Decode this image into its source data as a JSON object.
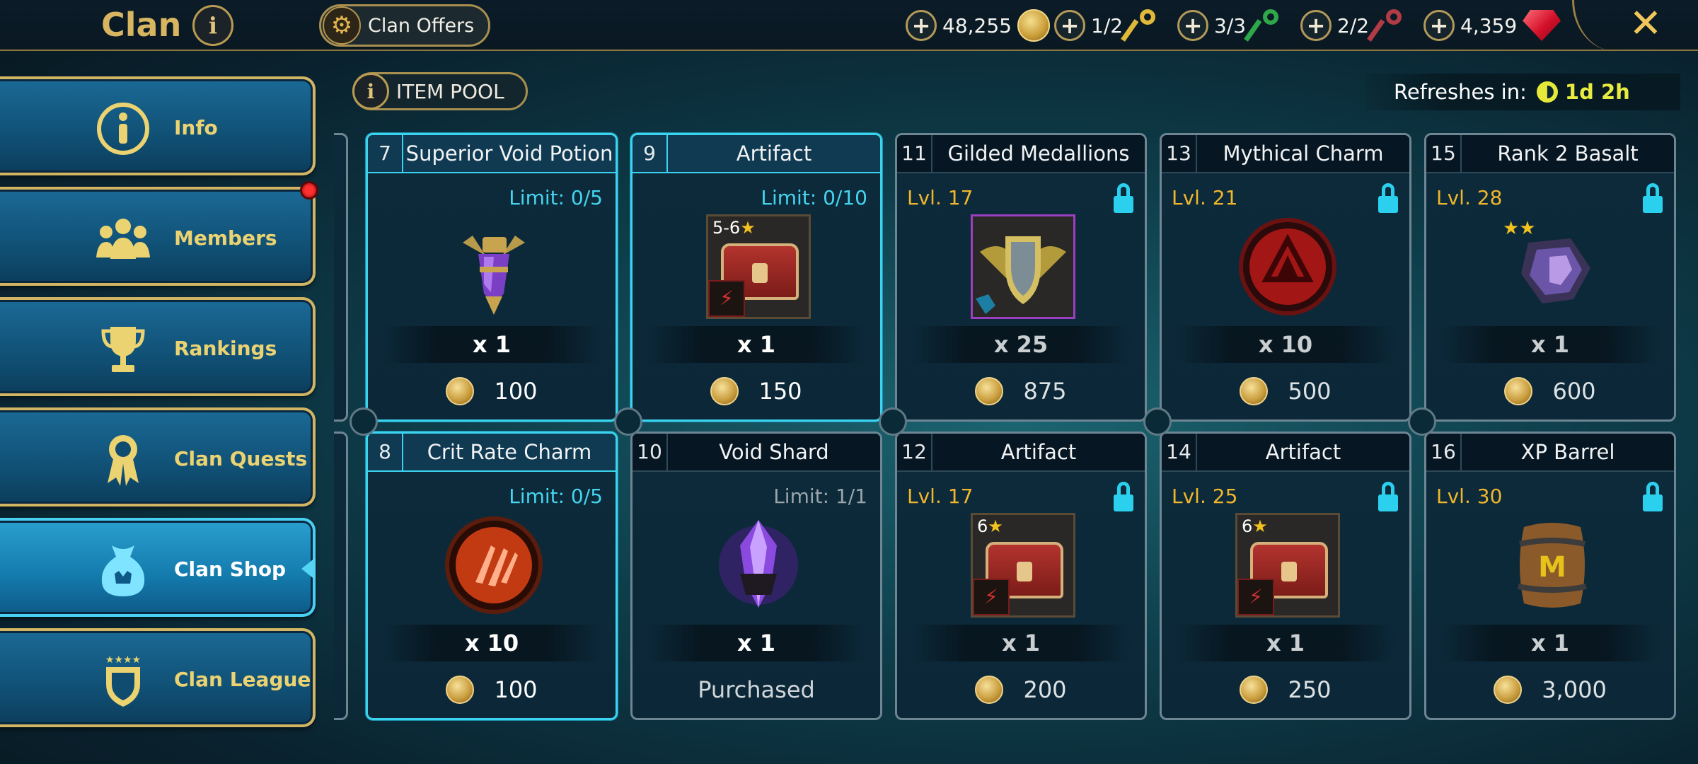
{
  "header": {
    "title": "Clan",
    "info_glyph": "i",
    "clan_offers_label": "Clan Offers",
    "close_glyph": "✕",
    "resources": [
      {
        "name": "clan-coins",
        "value": "48,255",
        "icon": "coin-icon"
      },
      {
        "name": "gold-keys",
        "value": "1/2",
        "icon": "gold-key-icon",
        "color": "#e0b93a"
      },
      {
        "name": "green-keys",
        "value": "3/3",
        "icon": "green-key-icon",
        "color": "#2fa84a"
      },
      {
        "name": "red-keys",
        "value": "2/2",
        "icon": "red-key-icon",
        "color": "#b23b46"
      },
      {
        "name": "gems",
        "value": "4,359",
        "icon": "ruby-icon"
      }
    ]
  },
  "sidebar": {
    "items": [
      {
        "label": "Info",
        "icon": "info-icon",
        "active": false
      },
      {
        "label": "Members",
        "icon": "members-icon",
        "active": false
      },
      {
        "label": "Rankings",
        "icon": "trophy-icon",
        "active": false
      },
      {
        "label": "Clan Quests",
        "icon": "medal-icon",
        "active": false
      },
      {
        "label": "Clan Shop",
        "icon": "bag-icon",
        "active": true
      },
      {
        "label": "Clan League",
        "icon": "shield-icon",
        "active": false
      }
    ]
  },
  "shop": {
    "item_pool_label": "ITEM POOL",
    "refresh_label": "Refreshes in:",
    "refresh_time": "1d 2h",
    "purchased_label": "Purchased",
    "cards": [
      {
        "num": "7",
        "title": "Superior Void Potion",
        "limit": "Limit: 0/5",
        "qty": "x 1",
        "price": "100",
        "state": "available",
        "icon": "void-potion-icon"
      },
      {
        "num": "9",
        "title": "Artifact",
        "limit": "Limit: 0/10",
        "stars": "5-6",
        "qty": "x 1",
        "price": "150",
        "state": "available",
        "icon": "artifact-chest-icon"
      },
      {
        "num": "11",
        "title": "Gilded Medallions",
        "level": "Lvl. 17",
        "qty": "x 25",
        "price": "875",
        "state": "locked",
        "icon": "medallion-icon"
      },
      {
        "num": "13",
        "title": "Mythical Charm",
        "level": "Lvl. 21",
        "qty": "x 10",
        "price": "500",
        "state": "locked",
        "icon": "mythical-charm-icon"
      },
      {
        "num": "15",
        "title": "Rank 2 Basalt",
        "level": "Lvl. 28",
        "qty": "x 1",
        "price": "600",
        "state": "locked",
        "icon": "basalt-icon"
      },
      {
        "num": "8",
        "title": "Crit Rate Charm",
        "limit": "Limit: 0/5",
        "qty": "x 10",
        "price": "100",
        "state": "available",
        "icon": "crit-charm-icon"
      },
      {
        "num": "10",
        "title": "Void Shard",
        "limit": "Limit: 1/1",
        "qty": "x 1",
        "price": "",
        "state": "purchased",
        "icon": "void-shard-icon"
      },
      {
        "num": "12",
        "title": "Artifact",
        "level": "Lvl. 17",
        "stars": "6",
        "qty": "x 1",
        "price": "200",
        "state": "locked",
        "icon": "artifact-chest-icon"
      },
      {
        "num": "14",
        "title": "Artifact",
        "level": "Lvl. 25",
        "stars": "6",
        "qty": "x 1",
        "price": "250",
        "state": "locked",
        "icon": "artifact-chest-icon"
      },
      {
        "num": "16",
        "title": "XP Barrel",
        "level": "Lvl. 30",
        "qty": "x 1",
        "price": "3,000",
        "state": "locked",
        "icon": "xp-barrel-icon"
      }
    ]
  },
  "colors": {
    "accent_gold": "#d8b560",
    "limit_cyan": "#45d4ef",
    "level_orange": "#f1b62c",
    "refresh_yellow": "#e8ec40"
  }
}
